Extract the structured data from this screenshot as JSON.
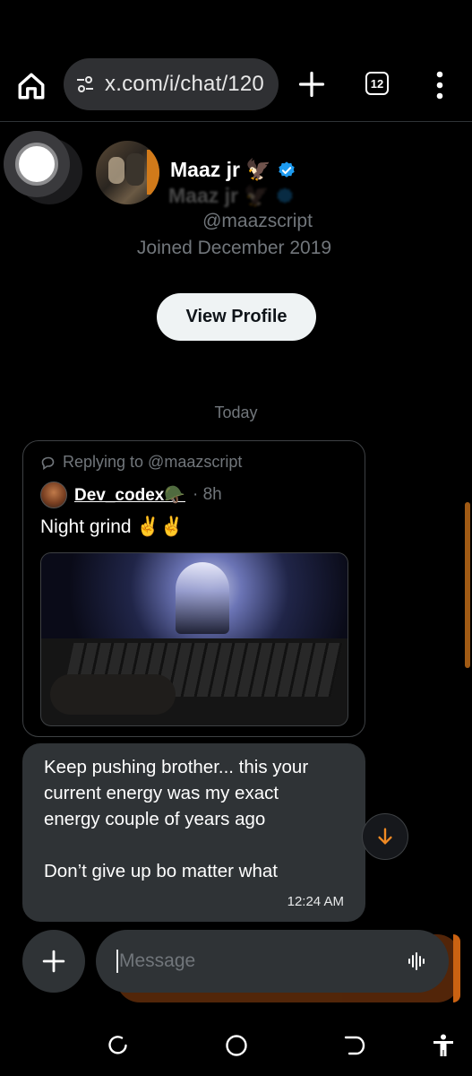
{
  "browser": {
    "url": "x.com/i/chat/120",
    "tab_count": "12"
  },
  "profile": {
    "display_name": "Maaz jr",
    "name_emoji": "🦅",
    "handle": "@maazscript",
    "joined": "Joined December 2019",
    "view_profile_label": "View Profile"
  },
  "conversation": {
    "date_separator": "Today",
    "shared_post": {
      "replying_to": "Replying to @maazscript",
      "author": "Dev_codex🪖",
      "time": "· 8h",
      "text": "Night grind ✌️✌️"
    },
    "message": {
      "lines": [
        "Keep pushing brother... this your",
        "current energy  was my exact",
        "energy couple of years ago",
        "",
        "Don’t give up bo matter what"
      ],
      "time": "12:24 AM"
    }
  },
  "composer": {
    "placeholder": "Message"
  },
  "colors": {
    "background": "#000000",
    "bubble": "#2f3336",
    "accent_orange": "#e06d14",
    "verified_blue": "#1d9bf0",
    "muted_text": "#71767b"
  },
  "icons": {
    "home": "home-icon",
    "site_settings": "tune-icon",
    "new_tab": "plus-icon",
    "tabs": "tab-count-icon",
    "menu": "more-vert-icon",
    "verified": "verified-badge-icon",
    "reply": "reply-bubble-icon",
    "scroll_down": "arrow-down-icon",
    "add": "plus-icon",
    "voice": "voice-wave-icon",
    "nav_recents": "recents-icon",
    "nav_home": "home-circle-icon",
    "nav_back": "back-icon",
    "accessibility": "accessibility-icon"
  }
}
